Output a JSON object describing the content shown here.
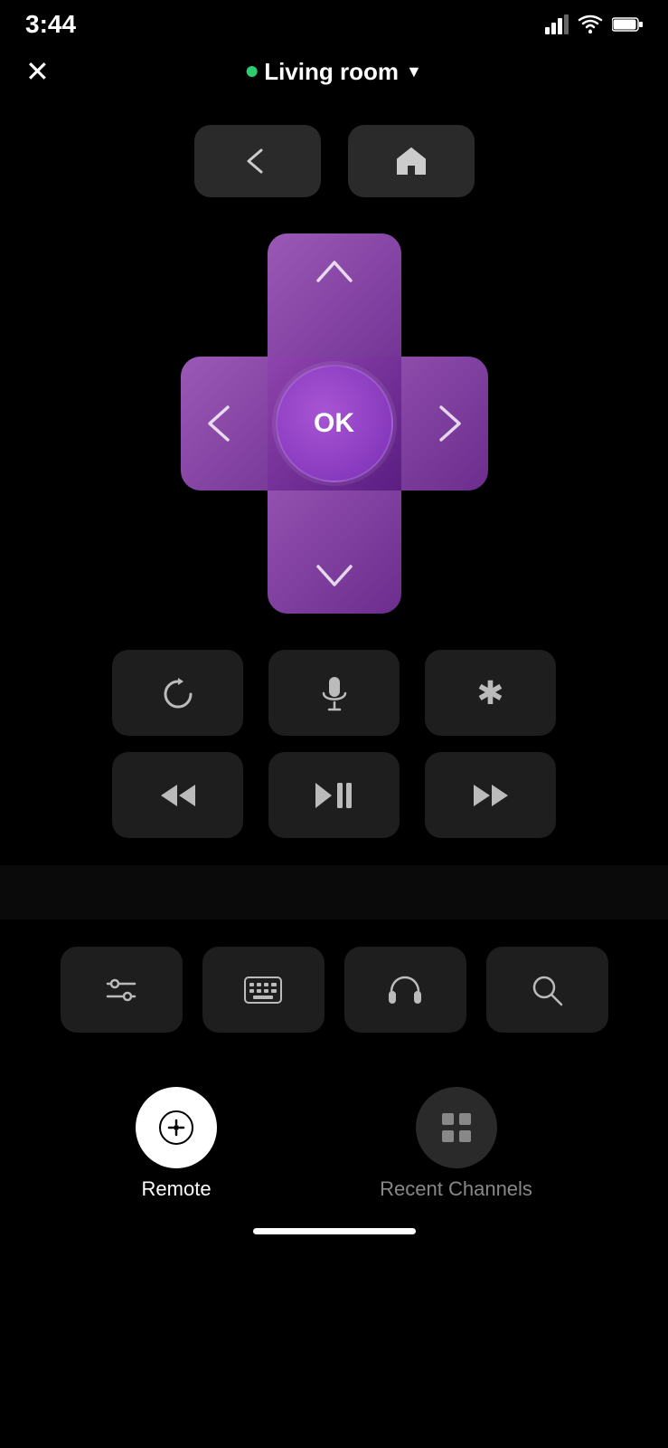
{
  "statusBar": {
    "time": "3:44",
    "signal": "▌▌▌",
    "wifi": "wifi",
    "battery": "battery"
  },
  "header": {
    "close_label": "✕",
    "device_dot_color": "#2ecc71",
    "device_name": "Living room",
    "dropdown_arrow": "▼"
  },
  "navButtons": {
    "back_label": "←",
    "home_label": "⌂"
  },
  "dpad": {
    "up_arrow": "^",
    "down_arrow": "v",
    "left_arrow": "<",
    "right_arrow": ">",
    "ok_label": "OK"
  },
  "mediaControls": {
    "row1": [
      {
        "id": "replay",
        "label": "↺"
      },
      {
        "id": "mic",
        "label": "🎤"
      },
      {
        "id": "asterisk",
        "label": "✱"
      }
    ],
    "row2": [
      {
        "id": "rewind",
        "label": "⏪"
      },
      {
        "id": "play_pause",
        "label": "⏯"
      },
      {
        "id": "fast_forward",
        "label": "⏩"
      }
    ]
  },
  "utilityButtons": [
    {
      "id": "settings",
      "label": "⚙"
    },
    {
      "id": "keyboard",
      "label": "⌨"
    },
    {
      "id": "headphones",
      "label": "🎧"
    },
    {
      "id": "search",
      "label": "🔍"
    }
  ],
  "tabBar": {
    "tabs": [
      {
        "id": "remote",
        "label": "Remote",
        "active": true
      },
      {
        "id": "recent_channels",
        "label": "Recent Channels",
        "active": false
      }
    ]
  }
}
